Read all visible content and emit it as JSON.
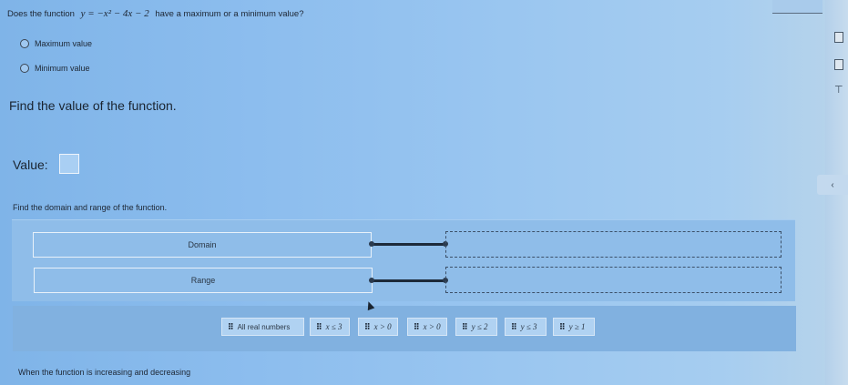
{
  "question": {
    "prefix": "Does the function",
    "function": "y = −x² − 4x − 2",
    "suffix": "have a maximum or a minimum value?"
  },
  "options": [
    {
      "label": "Maximum value"
    },
    {
      "label": "Minimum value"
    }
  ],
  "find_value": {
    "heading": "Find the value of the function.",
    "value_label": "Value:",
    "value_input": ""
  },
  "domain_range": {
    "prompt": "Find the domain and range of the function.",
    "domain_label": "Domain",
    "range_label": "Range"
  },
  "answer_choices": [
    {
      "label": "All real numbers"
    },
    {
      "label": "x ≤ 3"
    },
    {
      "label": "x > 0"
    },
    {
      "label": "x > 0"
    },
    {
      "label": "y ≤ 2"
    },
    {
      "label": "y ≤ 3"
    },
    {
      "label": "y ≥ 1"
    }
  ],
  "next_prompt": "When the function is increasing and decreasing",
  "side_tab_glyph": "‹",
  "colors": {
    "background": "#8cbdee",
    "connector": "#1d2a3a"
  }
}
